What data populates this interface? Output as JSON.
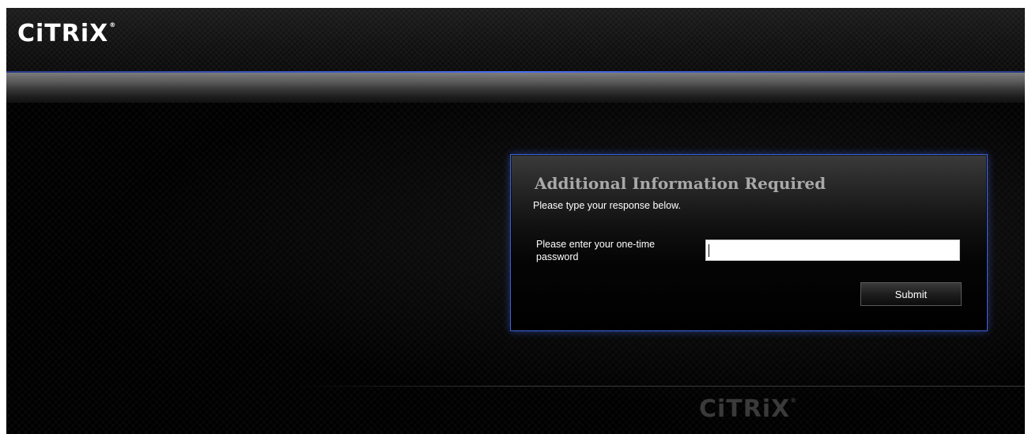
{
  "header": {
    "logo_text": "CiTRiX",
    "logo_registered": "®"
  },
  "panel": {
    "title": "Additional Information Required",
    "subtitle": "Please type your response below.",
    "field_label": "Please enter your one-time password",
    "field_value": "",
    "submit_label": "Submit"
  },
  "footer": {
    "logo_text": "CiTRiX",
    "logo_registered": "®"
  },
  "colors": {
    "accent_border": "#3b63d8",
    "background": "#000000",
    "title_text": "#a9a9a9"
  }
}
